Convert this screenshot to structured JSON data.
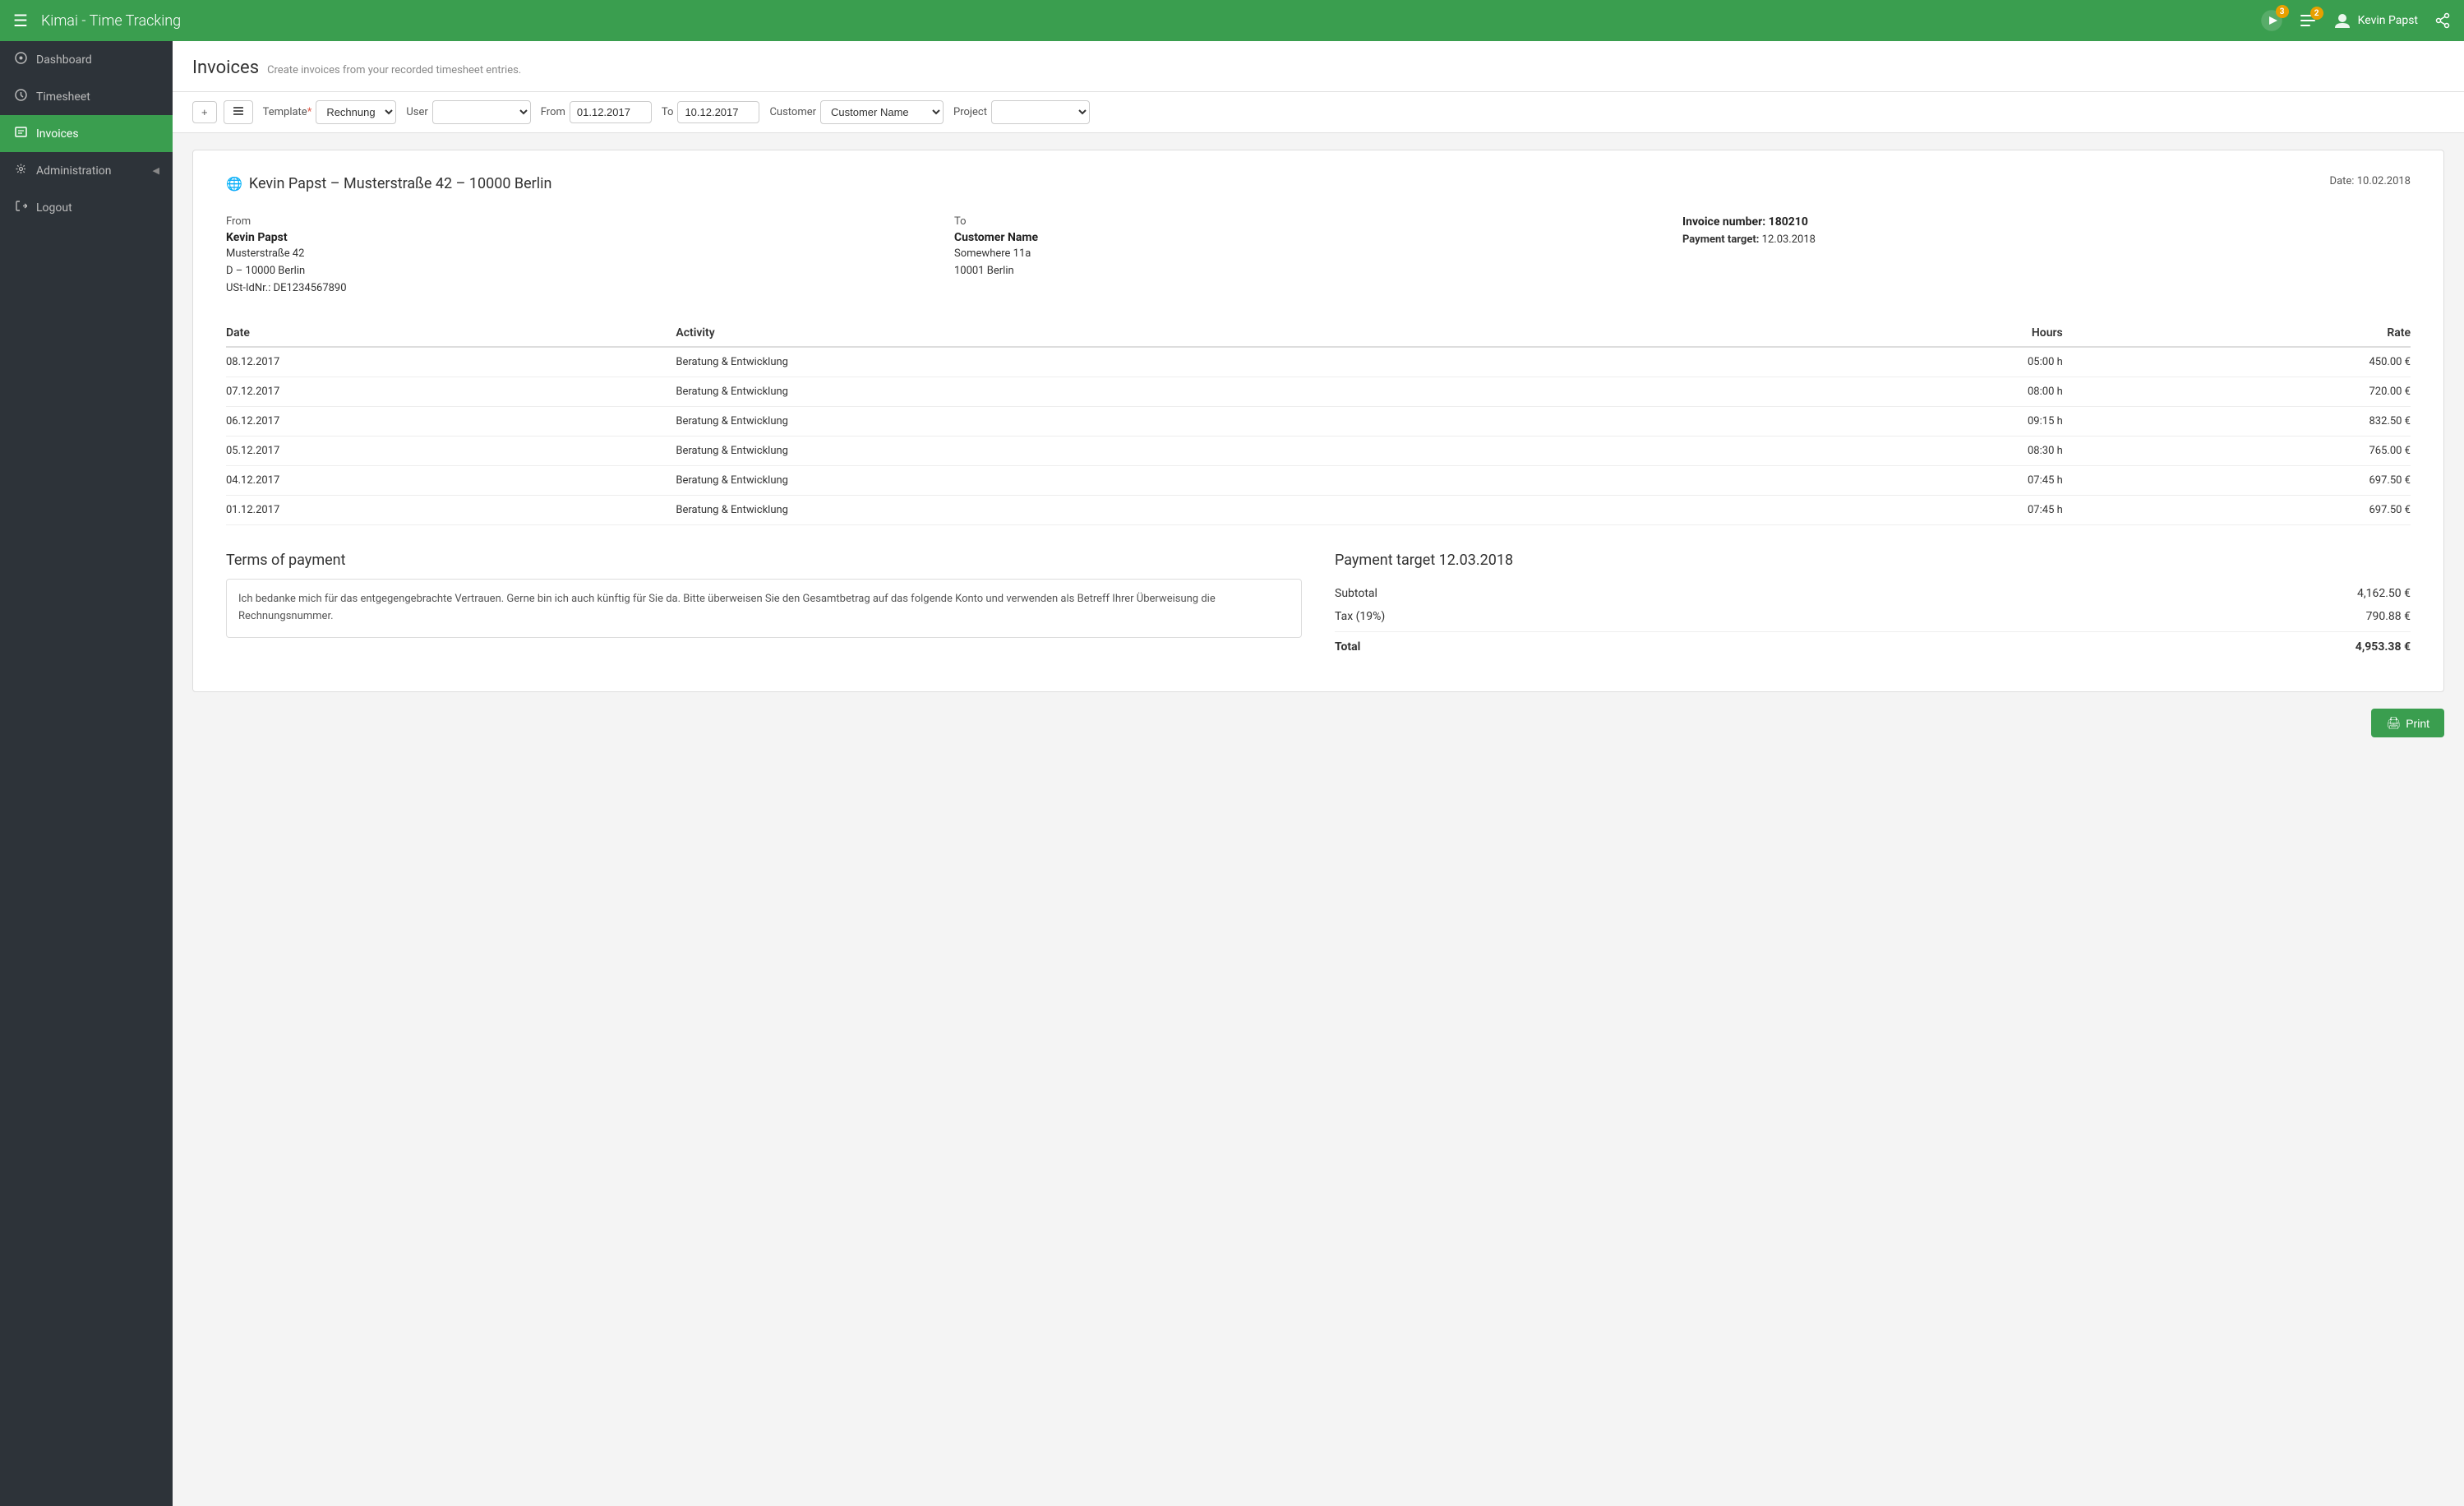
{
  "app": {
    "brand": "Kimai",
    "brand_subtitle": " - Time Tracking"
  },
  "topnav": {
    "menu_icon": "☰",
    "notifications_count": "3",
    "tasks_count": "2",
    "user_name": "Kevin Papst",
    "share_icon": "share"
  },
  "sidebar": {
    "items": [
      {
        "id": "dashboard",
        "label": "Dashboard",
        "icon": "⊙",
        "active": false
      },
      {
        "id": "timesheet",
        "label": "Timesheet",
        "icon": "◷",
        "active": false
      },
      {
        "id": "invoices",
        "label": "Invoices",
        "icon": "☰",
        "active": true
      },
      {
        "id": "administration",
        "label": "Administration",
        "icon": "⚙",
        "active": false,
        "has_arrow": true
      },
      {
        "id": "logout",
        "label": "Logout",
        "icon": "⏻",
        "active": false
      }
    ]
  },
  "page": {
    "title": "Invoices",
    "subtitle": "Create invoices from your recorded timesheet entries."
  },
  "filter": {
    "add_btn": "+",
    "list_btn": "≡",
    "template_label": "Template",
    "template_required": "*",
    "template_value": "Rechnung",
    "user_label": "User",
    "user_placeholder": "",
    "from_label": "From",
    "from_value": "01.12.2017",
    "to_label": "To",
    "to_value": "10.12.2017",
    "customer_label": "Customer",
    "customer_value": "Customer Name",
    "project_label": "Project",
    "project_value": ""
  },
  "invoice": {
    "business_name": "Kevin Papst – Musterstraße 42 – 10000 Berlin",
    "date_label": "Date:",
    "date_value": "10.02.2018",
    "from_label": "From",
    "from_name": "Kevin Papst",
    "from_street": "Musterstraße 42",
    "from_city": "D – 10000 Berlin",
    "from_tax": "USt-IdNr.: DE1234567890",
    "to_label": "To",
    "to_name": "Customer Name",
    "to_street": "Somewhere 11a",
    "to_city": "10001 Berlin",
    "invoice_number_label": "Invoice number: 180210",
    "payment_target_label": "Payment target:",
    "payment_target_value": "12.03.2018",
    "table_headers": {
      "date": "Date",
      "activity": "Activity",
      "hours": "Hours",
      "rate": "Rate"
    },
    "rows": [
      {
        "date": "08.12.2017",
        "activity": "Beratung & Entwicklung",
        "hours": "05:00 h",
        "rate": "450.00 €"
      },
      {
        "date": "07.12.2017",
        "activity": "Beratung & Entwicklung",
        "hours": "08:00 h",
        "rate": "720.00 €"
      },
      {
        "date": "06.12.2017",
        "activity": "Beratung & Entwicklung",
        "hours": "09:15 h",
        "rate": "832.50 €"
      },
      {
        "date": "05.12.2017",
        "activity": "Beratung & Entwicklung",
        "hours": "08:30 h",
        "rate": "765.00 €"
      },
      {
        "date": "04.12.2017",
        "activity": "Beratung & Entwicklung",
        "hours": "07:45 h",
        "rate": "697.50 €"
      },
      {
        "date": "01.12.2017",
        "activity": "Beratung & Entwicklung",
        "hours": "07:45 h",
        "rate": "697.50 €"
      }
    ],
    "terms_title": "Terms of payment",
    "terms_text": "Ich bedanke mich für das entgegengebrachte Vertrauen. Gerne bin ich auch künftig für Sie da. Bitte überweisen Sie den Gesamtbetrag auf das folgende Konto und verwenden als Betreff Ihrer Überweisung die Rechnungsnummer.",
    "payment_summary_title": "Payment target 12.03.2018",
    "subtotal_label": "Subtotal",
    "subtotal_value": "4,162.50 €",
    "tax_label": "Tax (19%)",
    "tax_value": "790.88 €",
    "total_label": "Total",
    "total_value": "4,953.38 €",
    "print_btn": "Print"
  },
  "colors": {
    "green": "#3a9e4f",
    "dark_sidebar": "#2d3339"
  }
}
